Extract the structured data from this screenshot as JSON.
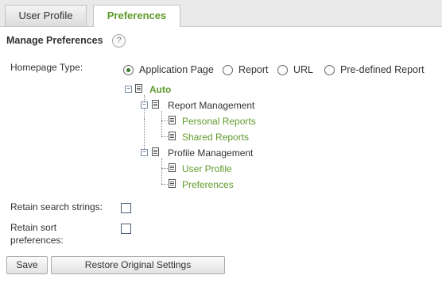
{
  "tabs": [
    {
      "label": "User Profile",
      "active": false
    },
    {
      "label": "Preferences",
      "active": true
    }
  ],
  "section": {
    "title": "Manage Preferences",
    "help_icon": "?"
  },
  "homepage": {
    "label": "Homepage Type:",
    "options": [
      "Application Page",
      "Report",
      "URL",
      "Pre-defined Report"
    ],
    "selected": "Application Page"
  },
  "tree": {
    "root": "Auto",
    "groups": [
      {
        "label": "Report Management",
        "children": [
          "Personal Reports",
          "Shared Reports"
        ]
      },
      {
        "label": "Profile Management",
        "children": [
          "User Profile",
          "Preferences"
        ]
      }
    ]
  },
  "retain_search": {
    "label": "Retain search strings:",
    "checked": false
  },
  "retain_sort": {
    "label_line1": "Retain sort",
    "label_line2": "preferences:",
    "checked": false
  },
  "buttons": {
    "save": "Save",
    "restore": "Restore Original Settings"
  },
  "colors": {
    "accent": "#5f9a2b",
    "tabbar": "#e9e9e9"
  }
}
